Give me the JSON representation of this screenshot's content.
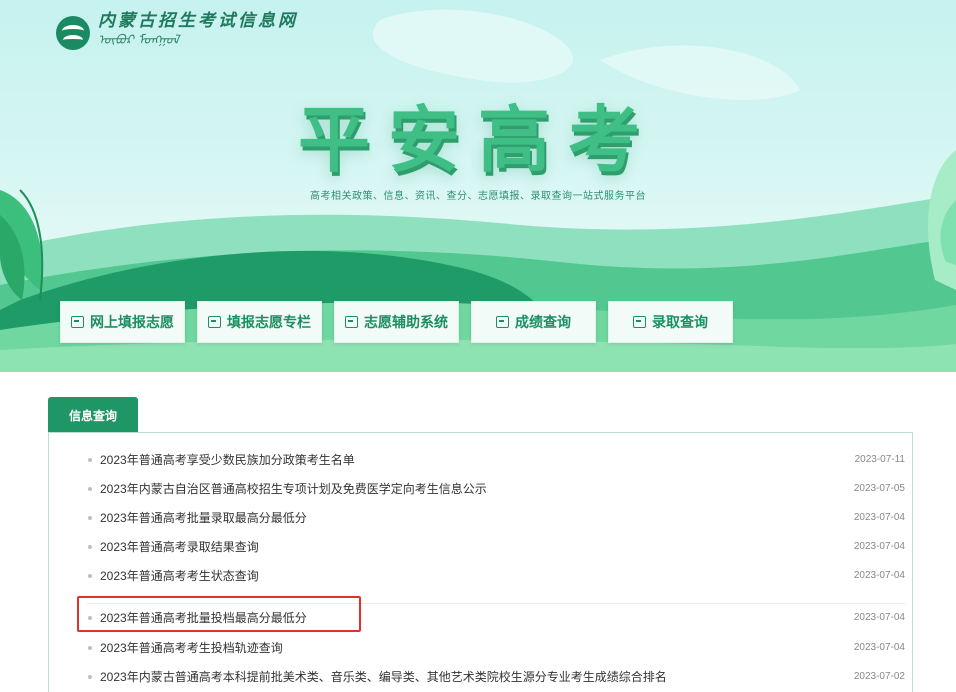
{
  "header": {
    "logo_text_cn": "内蒙古招生考试信息网",
    "logo_text_mn": "ᠦᠪᠦᠷ ᠮᠤᠩᠭᠤᠯ",
    "hero_title": "平安高考",
    "hero_subtitle": "高考相关政策、信息、资讯、查分、志愿填报、录取查询一站式服务平台"
  },
  "nav": [
    {
      "label": "网上填报志愿",
      "icon": "form-icon"
    },
    {
      "label": "填报志愿专栏",
      "icon": "monitor-icon"
    },
    {
      "label": "志愿辅助系统",
      "icon": "form-icon"
    },
    {
      "label": "成绩查询",
      "icon": "document-icon"
    },
    {
      "label": "录取查询",
      "icon": "form-icon"
    }
  ],
  "info": {
    "tab_label": "信息查询",
    "items": [
      {
        "title": "2023年普通高考享受少数民族加分政策考生名单",
        "date": "2023-07-11"
      },
      {
        "title": "2023年内蒙古自治区普通高校招生专项计划及免费医学定向考生信息公示",
        "date": "2023-07-05"
      },
      {
        "title": "2023年普通高考批量录取最高分最低分",
        "date": "2023-07-04"
      },
      {
        "title": "2023年普通高考录取结果查询",
        "date": "2023-07-04"
      },
      {
        "title": "2023年普通高考考生状态查询",
        "date": "2023-07-04"
      },
      {
        "title": "2023年普通高考批量投档最高分最低分",
        "date": "2023-07-04"
      },
      {
        "title": "2023年普通高考考生投档轨迹查询",
        "date": "2023-07-04"
      },
      {
        "title": "2023年内蒙古普通高考本科提前批美术类、音乐类、编导类、其他艺术类院校生源分专业考生成绩综合排名",
        "date": "2023-07-02"
      }
    ]
  },
  "colors": {
    "brand_green": "#1e9665",
    "highlight_red": "#e0312b"
  }
}
